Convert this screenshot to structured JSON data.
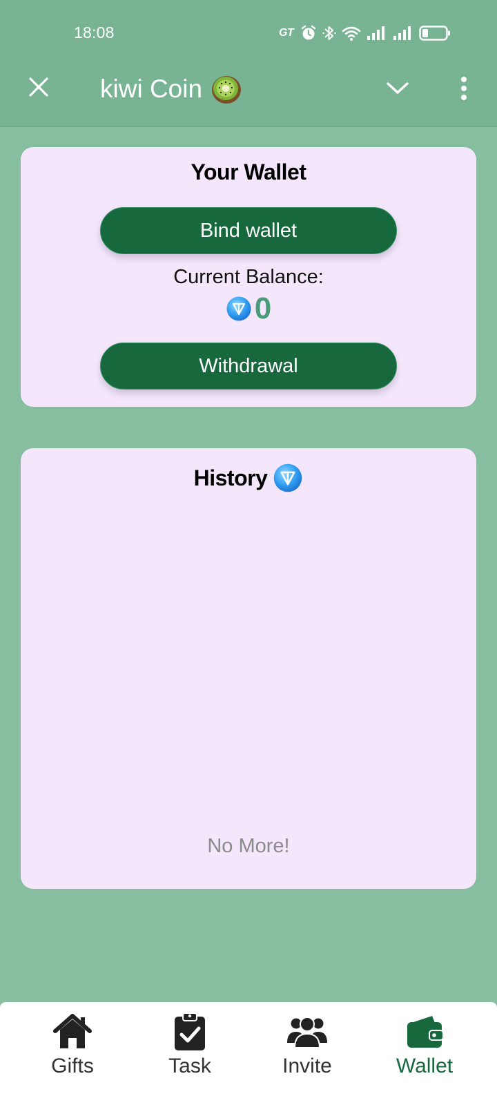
{
  "status_bar": {
    "time": "18:08",
    "carrier_badge": "GT"
  },
  "header": {
    "title": "kiwi Coin",
    "icons": {
      "close": "close-icon",
      "logo": "kiwi-fruit-icon",
      "chevron": "chevron-down-icon",
      "more": "more-vertical-icon"
    }
  },
  "wallet": {
    "title": "Your Wallet",
    "bind_label": "Bind wallet",
    "balance_label": "Current Balance:",
    "balance_value": "0",
    "balance_icon": "ton-coin-icon",
    "withdraw_label": "Withdrawal"
  },
  "history": {
    "title": "History",
    "title_icon": "ton-coin-icon",
    "empty_text": "No More!"
  },
  "nav": {
    "items": [
      {
        "label": "Gifts",
        "icon": "home-icon"
      },
      {
        "label": "Task",
        "icon": "clipboard-check-icon"
      },
      {
        "label": "Invite",
        "icon": "users-icon"
      },
      {
        "label": "Wallet",
        "icon": "wallet-icon"
      }
    ],
    "active_index": 3
  },
  "colors": {
    "background": "#88bea0",
    "header": "#78b494",
    "card": "#f4e7fc",
    "button": "#17683d",
    "balance": "#4a9b78",
    "nav_active": "#17683d"
  }
}
